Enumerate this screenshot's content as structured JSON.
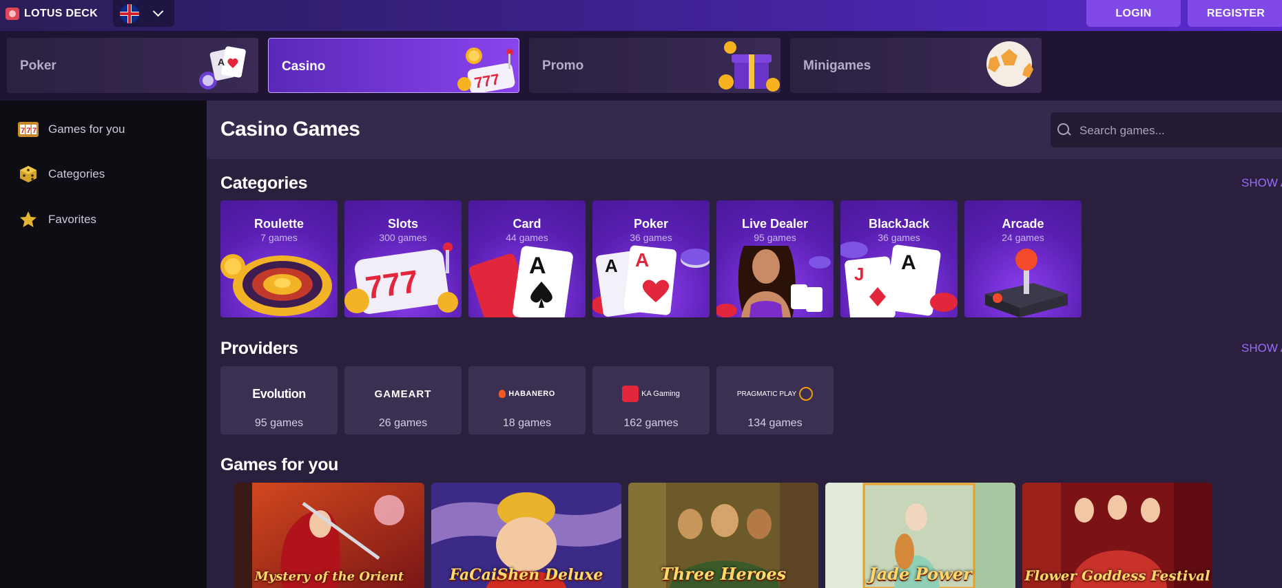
{
  "header": {
    "brand": "LOTUS DECK",
    "language": "English (UK)",
    "login_label": "LOGIN",
    "register_label": "REGISTER"
  },
  "tabs": [
    {
      "label": "Poker",
      "active": false
    },
    {
      "label": "Casino",
      "active": true
    },
    {
      "label": "Promo",
      "active": false
    },
    {
      "label": "Minigames",
      "active": false
    }
  ],
  "sidebar": {
    "items": [
      {
        "label": "Games for you",
        "icon": "slot-777-icon"
      },
      {
        "label": "Categories",
        "icon": "dice-icon"
      },
      {
        "label": "Favorites",
        "icon": "star-icon"
      }
    ]
  },
  "main": {
    "title": "Casino Games",
    "search_placeholder": "Search games...",
    "categories_title": "Categories",
    "providers_title": "Providers",
    "games_title": "Games for you",
    "show_all_label": "SHOW A"
  },
  "categories": [
    {
      "name": "Roulette",
      "count": "7 games"
    },
    {
      "name": "Slots",
      "count": "300 games"
    },
    {
      "name": "Card",
      "count": "44 games"
    },
    {
      "name": "Poker",
      "count": "36 games"
    },
    {
      "name": "Live Dealer",
      "count": "95 games"
    },
    {
      "name": "BlackJack",
      "count": "36 games"
    },
    {
      "name": "Arcade",
      "count": "24 games"
    }
  ],
  "providers": [
    {
      "logo": "Evolution",
      "count": "95 games"
    },
    {
      "logo": "GAMEART",
      "count": "26 games"
    },
    {
      "logo": "HABANERO",
      "count": "18 games"
    },
    {
      "logo": "KA Gaming",
      "count": "162 games"
    },
    {
      "logo": "PRAGMATIC PLAY",
      "count": "134 games"
    }
  ],
  "games": [
    {
      "title": "Mystery of the Orient"
    },
    {
      "title": "FaCaiShen Deluxe"
    },
    {
      "title": "Three Heroes"
    },
    {
      "title": "Jade Power"
    },
    {
      "title": "Flower Goddess Festival"
    }
  ],
  "colors": {
    "accent": "#8148e8",
    "sidebar_bg": "#0d0d13",
    "main_bg": "#2a1f3d",
    "link": "#9a6cff"
  }
}
